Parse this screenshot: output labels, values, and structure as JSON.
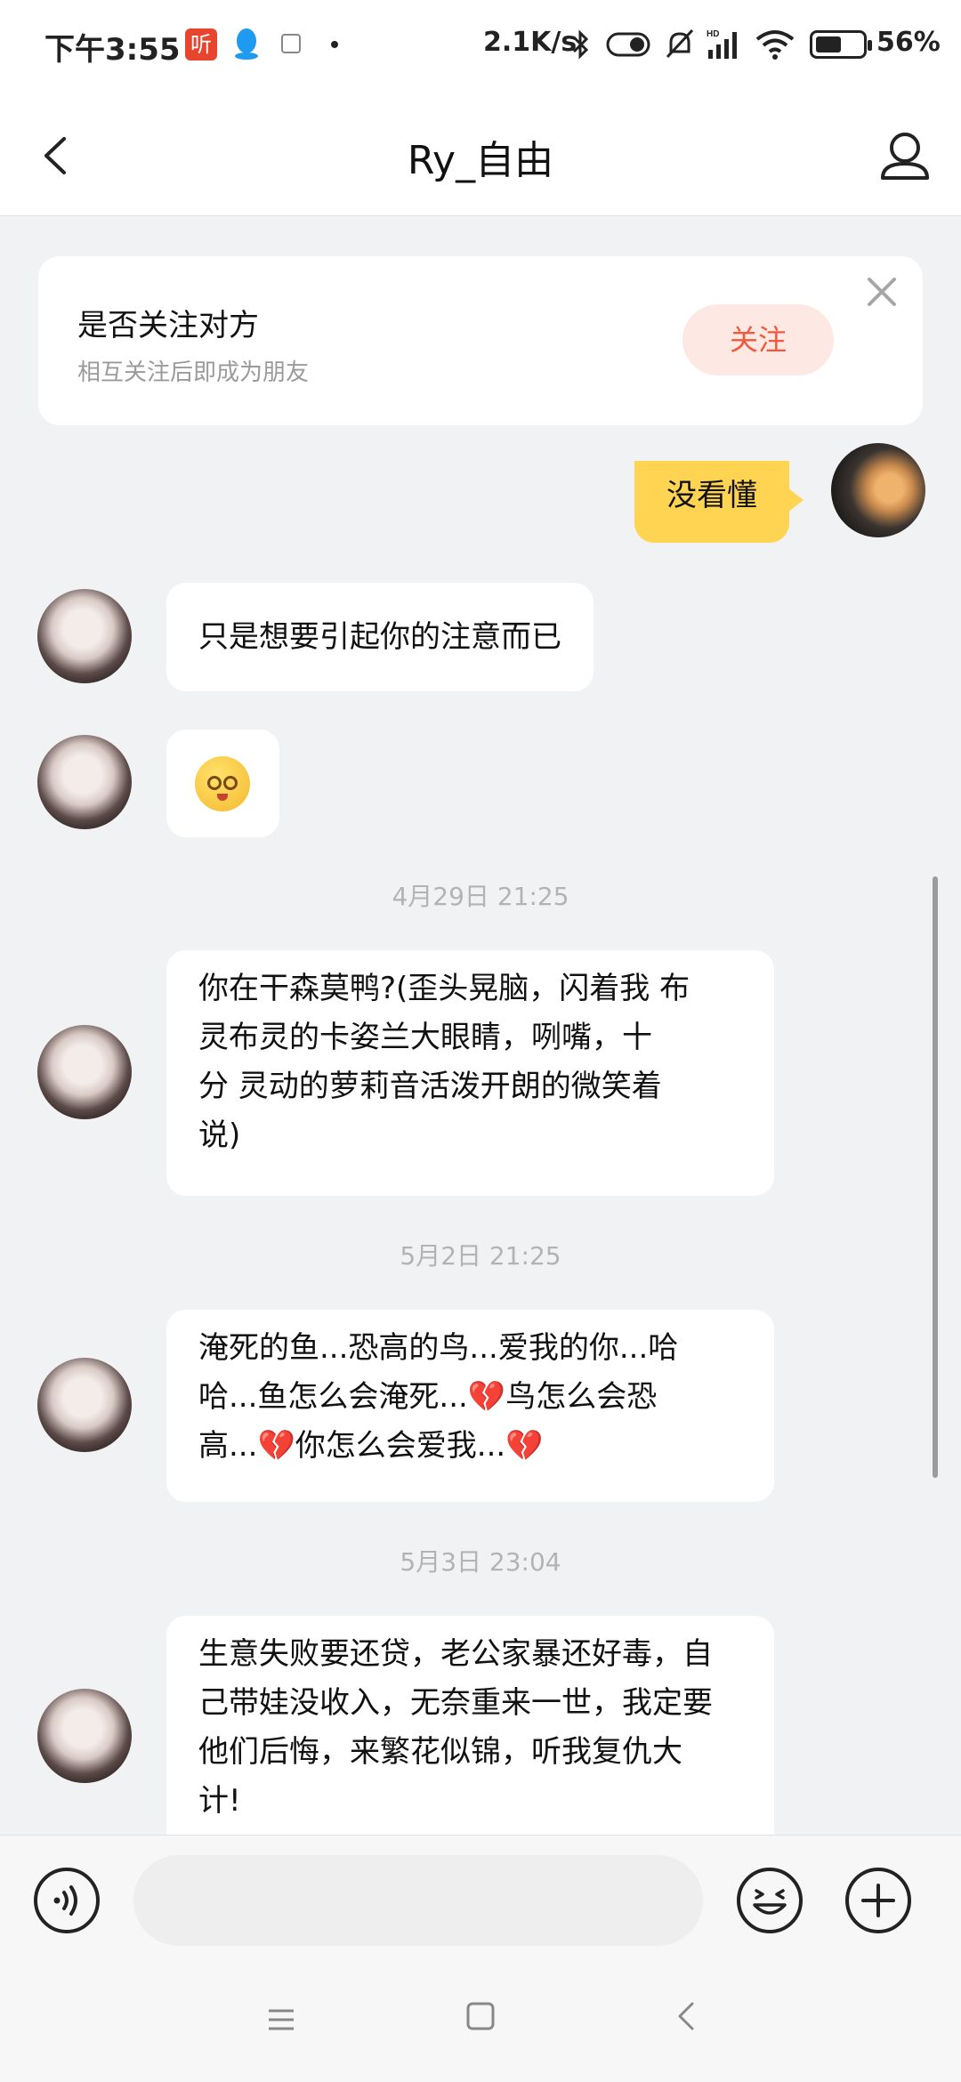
{
  "status_bar": {
    "time": "下午3:55",
    "app_icon_text": "听",
    "net_speed": "2.1K/s",
    "battery": "56%",
    "battery_level": 0.56
  },
  "header": {
    "title": "Ry_自由"
  },
  "follow_card": {
    "title": "是否关注对方",
    "subtitle": "相互关注后即成为朋友",
    "button": "关注"
  },
  "messages": [
    {
      "from": "me",
      "text": "没看懂"
    },
    {
      "from": "them",
      "text": "只是想要引起你的注意而已"
    },
    {
      "from": "them",
      "type": "emoji",
      "emoji": "flushed-face"
    },
    {
      "timestamp": "4月29日 21:25"
    },
    {
      "from": "them",
      "lines": [
        "你在干森莫鸭?(歪头晃脑，闪着我 布",
        "灵布灵的卡姿兰大眼睛，咧嘴，十",
        "分 灵动的萝莉音活泼开朗的微笑着",
        "说)"
      ]
    },
    {
      "timestamp": "5月2日 21:25"
    },
    {
      "from": "them",
      "parts": [
        "淹死的鱼...恐高的鸟...爱我的你...哈",
        "哈...鱼怎么会淹死...",
        "鸟怎么会恐",
        "高...",
        "你怎么会爱我..."
      ]
    },
    {
      "timestamp": "5月3日 23:04"
    },
    {
      "from": "them",
      "lines": [
        "生意失败要还贷，老公家暴还好毒，自",
        "己带娃没收入，无奈重来一世，我定要",
        "他们后悔，来繁花似锦，听我复仇大",
        "计!"
      ]
    }
  ],
  "input": {
    "placeholder": ""
  },
  "icons": {
    "heart": "💔"
  }
}
